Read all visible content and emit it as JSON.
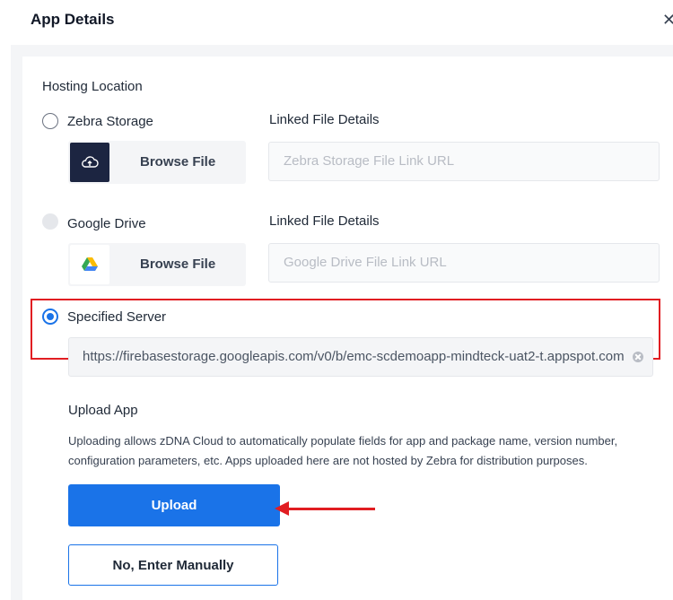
{
  "dialog": {
    "title": "App Details",
    "close_glyph": "✕"
  },
  "hosting": {
    "section_label": "Hosting Location",
    "options": [
      {
        "label": "Zebra Storage",
        "state": "unselected",
        "field_label": "Linked File Details",
        "browse_label": "Browse File",
        "browse_icon": "cloud-upload-icon",
        "link_placeholder": "Zebra Storage File Link URL"
      },
      {
        "label": "Google Drive",
        "state": "disabled",
        "field_label": "Linked File Details",
        "browse_label": "Browse File",
        "browse_icon": "google-drive-icon",
        "link_placeholder": "Google Drive File Link URL"
      },
      {
        "label": "Specified Server",
        "state": "selected",
        "url_value": "https://firebasestorage.googleapis.com/v0/b/emc-scdemoapp-mindteck-uat2-t.appspot.com"
      }
    ]
  },
  "upload": {
    "title": "Upload App",
    "description": "Uploading allows zDNA Cloud to automatically populate fields for app and package name, version number, configuration parameters, etc. Apps uploaded here are not hosted by Zebra for distribution purposes.",
    "upload_button": "Upload",
    "manual_button": "No, Enter Manually"
  },
  "colors": {
    "accent": "#1a73e8",
    "highlight": "#e11d22",
    "zebra_icon_bg": "#1c2541"
  }
}
